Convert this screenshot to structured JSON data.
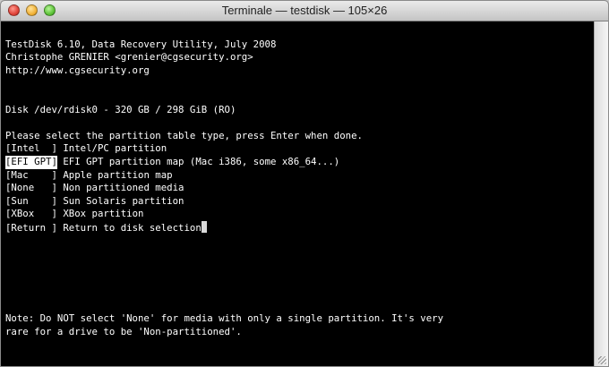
{
  "window": {
    "title": "Terminale — testdisk — 105×26"
  },
  "terminal": {
    "header": [
      "TestDisk 6.10, Data Recovery Utility, July 2008",
      "Christophe GRENIER <grenier@cgsecurity.org>",
      "http://www.cgsecurity.org"
    ],
    "disk": "Disk /dev/rdisk0 - 320 GB / 298 GiB (RO)",
    "prompt": "Please select the partition table type, press Enter when done.",
    "options": [
      {
        "key": "[Intel  ]",
        "desc": "Intel/PC partition"
      },
      {
        "key": "[EFI GPT]",
        "desc": "EFI GPT partition map (Mac i386, some x86_64...)"
      },
      {
        "key": "[Mac    ]",
        "desc": "Apple partition map"
      },
      {
        "key": "[None   ]",
        "desc": "Non partitioned media"
      },
      {
        "key": "[Sun    ]",
        "desc": "Sun Solaris partition"
      },
      {
        "key": "[XBox   ]",
        "desc": "XBox partition"
      },
      {
        "key": "[Return ]",
        "desc": "Return to disk selection"
      }
    ],
    "selected_option": "[EFI GPT]",
    "note": [
      "Note: Do NOT select 'None' for media with only a single partition. It's very",
      "rare for a drive to be 'Non-partitioned'."
    ]
  }
}
